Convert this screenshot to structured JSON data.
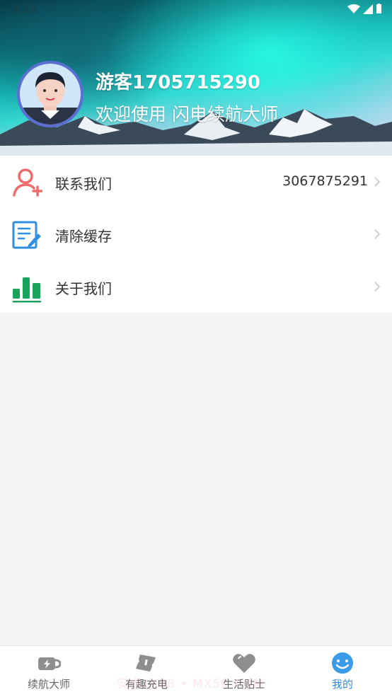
{
  "status_bar": {
    "time": "9:48"
  },
  "profile": {
    "username": "游客1705715290",
    "welcome": "欢迎使用 闪电续航大师"
  },
  "menu": [
    {
      "label": "联系我们",
      "value": "3067875291",
      "icon": "add-contact-icon",
      "icon_color": "#f06b6b"
    },
    {
      "label": "清除缓存",
      "value": "",
      "icon": "edit-document-icon",
      "icon_color": "#2f8fe0"
    },
    {
      "label": "关于我们",
      "value": "",
      "icon": "bar-chart-icon",
      "icon_color": "#1aa35a"
    }
  ],
  "bottom_nav": [
    {
      "label": "续航大师",
      "icon": "battery-cup-icon",
      "active": false
    },
    {
      "label": "有趣充电",
      "icon": "ticket-icon",
      "active": false
    },
    {
      "label": "生活贴士",
      "icon": "heart-icon",
      "active": false
    },
    {
      "label": "我的",
      "icon": "smiley-icon",
      "active": true
    }
  ],
  "watermark": "安卓1688 • MX5E.COM",
  "colors": {
    "accent": "#2f8fe0",
    "inactive_nav": "#9a9a9a"
  }
}
